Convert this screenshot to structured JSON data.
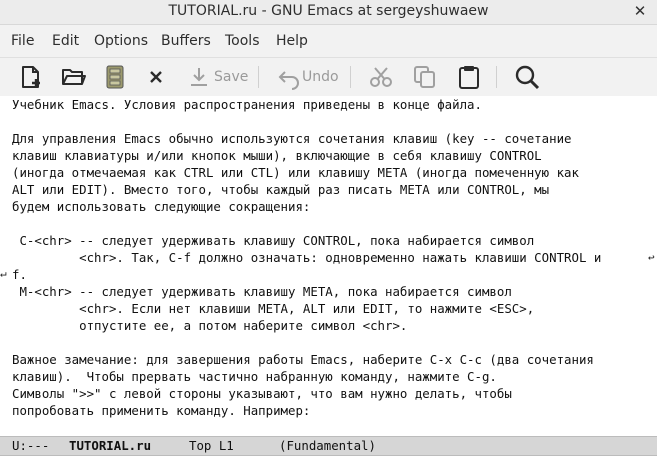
{
  "window": {
    "title": "TUTORIAL.ru - GNU Emacs at sergeyshuwaew",
    "close_glyph": "✕"
  },
  "menu": [
    "File",
    "Edit",
    "Options",
    "Buffers",
    "Tools",
    "Help"
  ],
  "toolbar": {
    "save_label": "Save",
    "undo_label": "Undo",
    "icons": [
      "new-file-icon",
      "open-folder-icon",
      "save-disk-icon",
      "close-buffer-icon",
      "save-icon",
      "undo-icon",
      "cut-icon",
      "copy-icon",
      "paste-icon",
      "search-icon"
    ]
  },
  "buffer": {
    "lines": [
      "Учебник Emacs. Условия распространения приведены в конце файла.",
      "",
      "Для управления Emacs обычно используются сочетания клавиш (key -- сочетание",
      "клавиш клавиатуры и/или кнопок мыши), включающие в себя клавишу CONTROL",
      "(иногда отмечаемая как CTRL или CTL) или клавишу META (иногда помеченную как",
      "ALT или EDIT). Вместо того, чтобы каждый раз писать META или CONTROL, мы",
      "будем использовать следующие сокращения:",
      "",
      " C-<chr> -- следует удерживать клавишу CONTROL, пока набирается символ",
      "         <chr>. Так, C-f должно означать: одновременно нажать клавиши CONTROL и",
      "f.",
      " M-<chr> -- следует удерживать клавишу META, пока набирается символ",
      "         <chr>. Если нет клавиши META, ALT или EDIT, то нажмите <ESC>,",
      "         отпустите ее, а потом наберите символ <chr>.",
      "",
      "Важное замечание: для завершения работы Emacs, наберите C-x C-c (два сочетания",
      "клавиш).  Чтобы прервать частично набранную команду, нажмите C-g.",
      "Символы \">>\" с левой стороны указывают, что вам нужно делать, чтобы",
      "попробовать применить команду. Например:"
    ],
    "fringe_left": "↵",
    "fringe_right": "↩"
  },
  "modeline": {
    "status": "U:---",
    "buffer_name": "TUTORIAL.ru",
    "position": "Top L1",
    "mode": "(Fundamental)"
  },
  "colors": {
    "text": "#111111",
    "modeline_bg": "#d6d6d6",
    "toolbar_bg": "#f2f2f2",
    "disabled": "#9a9a9a"
  }
}
